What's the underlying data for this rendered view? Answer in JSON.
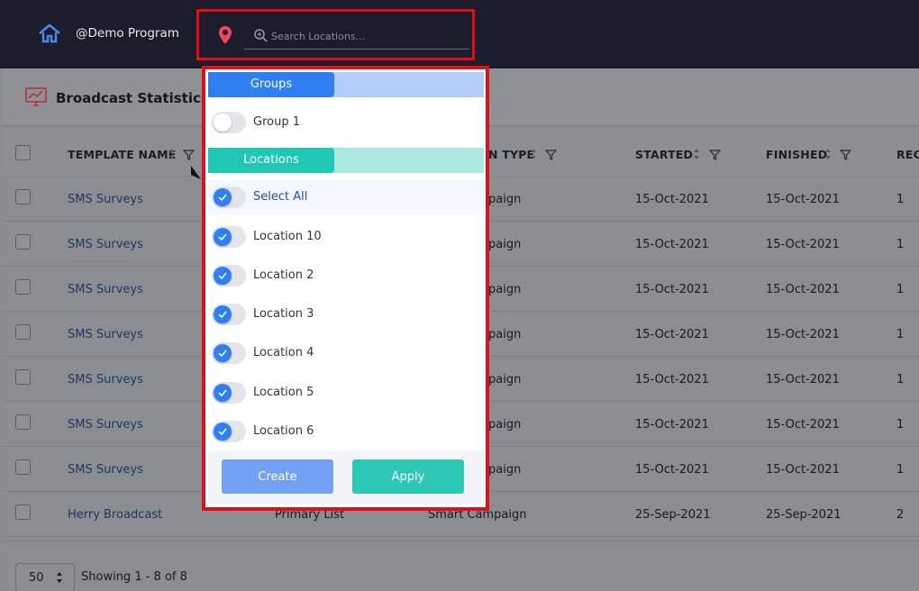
{
  "topbar": {
    "program": "@Demo Program",
    "search_placeholder": "Search Locations..."
  },
  "card": {
    "title": "Broadcast Statistics"
  },
  "table": {
    "headers": {
      "template_name": "TEMPLATE NAME",
      "type": "N TYPE",
      "started": "STARTED",
      "finished": "FINISHED",
      "recipients": "REC"
    },
    "rows": [
      {
        "name": "SMS Surveys",
        "type": "paign",
        "started": "15-Oct-2021",
        "finished": "15-Oct-2021",
        "count": "1"
      },
      {
        "name": "SMS Surveys",
        "type": "paign",
        "started": "15-Oct-2021",
        "finished": "15-Oct-2021",
        "count": "1"
      },
      {
        "name": "SMS Surveys",
        "type": "paign",
        "started": "15-Oct-2021",
        "finished": "15-Oct-2021",
        "count": "1"
      },
      {
        "name": "SMS Surveys",
        "type": "paign",
        "started": "15-Oct-2021",
        "finished": "15-Oct-2021",
        "count": "1"
      },
      {
        "name": "SMS Surveys",
        "type": "paign",
        "started": "15-Oct-2021",
        "finished": "15-Oct-2021",
        "count": "1"
      },
      {
        "name": "SMS Surveys",
        "type": "paign",
        "started": "15-Oct-2021",
        "finished": "15-Oct-2021",
        "count": "1"
      },
      {
        "name": "SMS Surveys",
        "type": "paign",
        "started": "15-Oct-2021",
        "finished": "15-Oct-2021",
        "count": "1"
      },
      {
        "name": "Herry Broadcast",
        "list": "Primary List",
        "type": "Smart Campaign",
        "started": "25-Sep-2021",
        "finished": "25-Sep-2021",
        "count": "2"
      }
    ]
  },
  "footer": {
    "page_size": "50",
    "showing": "Showing 1 - 8 of 8"
  },
  "dropdown": {
    "groups_label": "Groups",
    "groups": [
      {
        "label": "Group 1",
        "on": false
      }
    ],
    "locations_label": "Locations",
    "select_all": "Select All",
    "locations": [
      {
        "label": "Location 10",
        "on": true
      },
      {
        "label": "Location 2",
        "on": true
      },
      {
        "label": "Location 3",
        "on": true
      },
      {
        "label": "Location 4",
        "on": true
      },
      {
        "label": "Location 5",
        "on": true
      },
      {
        "label": "Location 6",
        "on": true
      }
    ],
    "create_label": "Create",
    "apply_label": "Apply"
  },
  "colors": {
    "nav_bg": "#1d1c2b",
    "highlight_border": "#e0101a",
    "primary_blue": "#2f7ff0",
    "teal": "#20c7b2"
  },
  "icons": [
    "home-icon",
    "map-pin-icon",
    "search-icon",
    "stats-chart-icon",
    "sort-icon",
    "filter-icon",
    "check-icon"
  ]
}
